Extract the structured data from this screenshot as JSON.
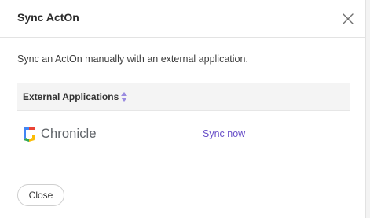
{
  "dialog": {
    "title": "Sync ActOn",
    "description": "Sync an ActOn manually with an external application."
  },
  "table": {
    "header": "External Applications",
    "rows": [
      {
        "app_name": "Chronicle",
        "action": "Sync now"
      }
    ]
  },
  "footer": {
    "close_label": "Close"
  },
  "colors": {
    "link": "#6a51c9",
    "sort_icon": "#9a8be0"
  },
  "icons": {
    "close": "close-icon",
    "sort": "sort-icon",
    "logo": "chronicle-logo-icon"
  }
}
